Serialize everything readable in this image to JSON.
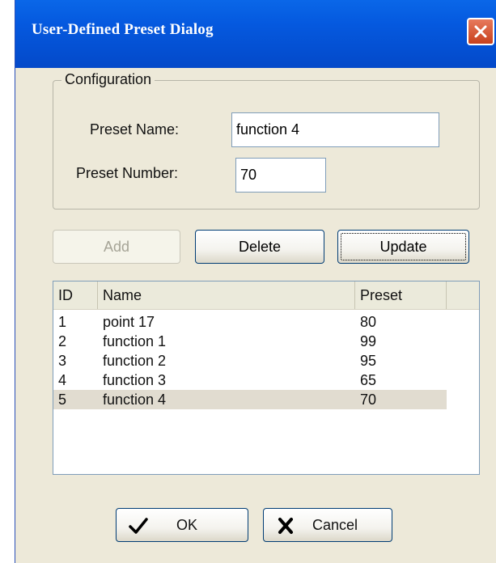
{
  "dialog": {
    "title": "User-Defined Preset Dialog",
    "close_icon": "close-icon"
  },
  "configuration": {
    "legend": "Configuration",
    "preset_name_label": "Preset Name:",
    "preset_name_value": "function 4",
    "preset_number_label": "Preset Number:",
    "preset_number_value": "70"
  },
  "actions": {
    "add_label": "Add",
    "delete_label": "Delete",
    "update_label": "Update"
  },
  "table": {
    "columns": [
      "ID",
      "Name",
      "Preset"
    ],
    "rows": [
      {
        "id": "1",
        "name": "point 17",
        "preset": "80"
      },
      {
        "id": "2",
        "name": "function 1",
        "preset": "99"
      },
      {
        "id": "3",
        "name": "function 2",
        "preset": "95"
      },
      {
        "id": "4",
        "name": "function 3",
        "preset": "65"
      },
      {
        "id": "5",
        "name": "function 4",
        "preset": "70"
      }
    ],
    "selected_row": 4
  },
  "footer": {
    "ok_label": "OK",
    "ok_icon": "checkmark-icon",
    "cancel_label": "Cancel",
    "cancel_icon": "x-mark-icon"
  },
  "colors": {
    "titlebar": "#0559df",
    "dialog_bg": "#ede9d9",
    "close_button": "#d2502b",
    "selected_row": "#e1dcd0"
  }
}
